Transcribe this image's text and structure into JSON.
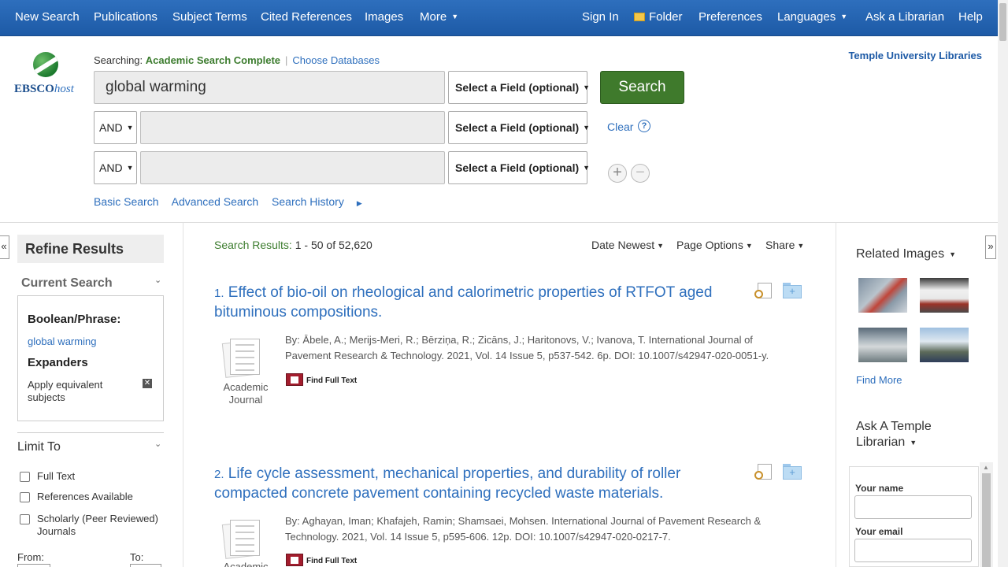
{
  "nav": {
    "left": [
      "New Search",
      "Publications",
      "Subject Terms",
      "Cited References",
      "Images",
      "More"
    ],
    "right": [
      "Sign In",
      "Folder",
      "Preferences",
      "Languages",
      "Ask a Librarian",
      "Help"
    ]
  },
  "header": {
    "logo_text": "EBSCO",
    "logo_text_italic": "host",
    "searching_label": "Searching:",
    "database": "Academic Search Complete",
    "choose_databases": "Choose Databases",
    "institution": "Temple University Libraries"
  },
  "search": {
    "query": "global warming",
    "field_placeholder": "Select a Field (optional)",
    "bool1": "AND",
    "bool2": "AND",
    "search_button": "Search",
    "clear": "Clear",
    "help": "?",
    "links": [
      "Basic Search",
      "Advanced Search",
      "Search History"
    ]
  },
  "refine": {
    "title": "Refine Results",
    "current_search": "Current Search",
    "boolean_label": "Boolean/Phrase:",
    "boolean_value": "global warming",
    "expanders_label": "Expanders",
    "expander_value": "Apply equivalent subjects",
    "limit_to": "Limit To",
    "limits": [
      "Full Text",
      "References Available",
      "Scholarly (Peer Reviewed) Journals"
    ],
    "from": "From:",
    "to": "To:"
  },
  "results": {
    "label": "Search Results:",
    "range": "1 - 50 of 52,620",
    "options": [
      "Date Newest",
      "Page Options",
      "Share"
    ],
    "items": [
      {
        "num": "1.",
        "title": "Effect of bio-oil on rheological and calorimetric properties of RTFOT aged bituminous compositions.",
        "meta": "By: Ābele, A.; Merijs-Meri, R.; Bērziņa, R.; Zicāns, J.; Haritonovs, V.; Ivanova, T. International Journal of Pavement Research & Technology. 2021, Vol. 14 Issue 5, p537-542. 6p. DOI: 10.1007/s42947-020-0051-y.",
        "type_line1": "Academic",
        "type_line2": "Journal",
        "find": "Find Full Text"
      },
      {
        "num": "2.",
        "title": "Life cycle assessment, mechanical properties, and durability of roller compacted concrete pavement containing recycled waste materials.",
        "meta": "By: Aghayan, Iman; Khafajeh, Ramin; Shamsaei, Mohsen. International Journal of Pavement Research & Technology. 2021, Vol. 14 Issue 5, p595-606. 12p. DOI: 10.1007/s42947-020-0217-7.",
        "type_line1": "Academic",
        "find": "Find Full Text"
      }
    ]
  },
  "right": {
    "related_images": "Related Images",
    "find_more": "Find More",
    "ask_line1": "Ask A Temple",
    "ask_line2": "Librarian",
    "your_name": "Your name",
    "your_email": "Your email"
  },
  "colors": {
    "nav": "#1d5aa6",
    "link": "#2e6fbd",
    "search_button": "#3f7a2c",
    "database": "#3c7c2e"
  },
  "icons": [
    "caret-down-icon",
    "folder-icon",
    "help-icon",
    "plus-icon",
    "minus-icon",
    "collapse-left-icon",
    "collapse-right-icon",
    "preview-icon",
    "add-to-folder-icon",
    "pdf-full-text-icon",
    "remove-x-icon",
    "document-icon"
  ]
}
